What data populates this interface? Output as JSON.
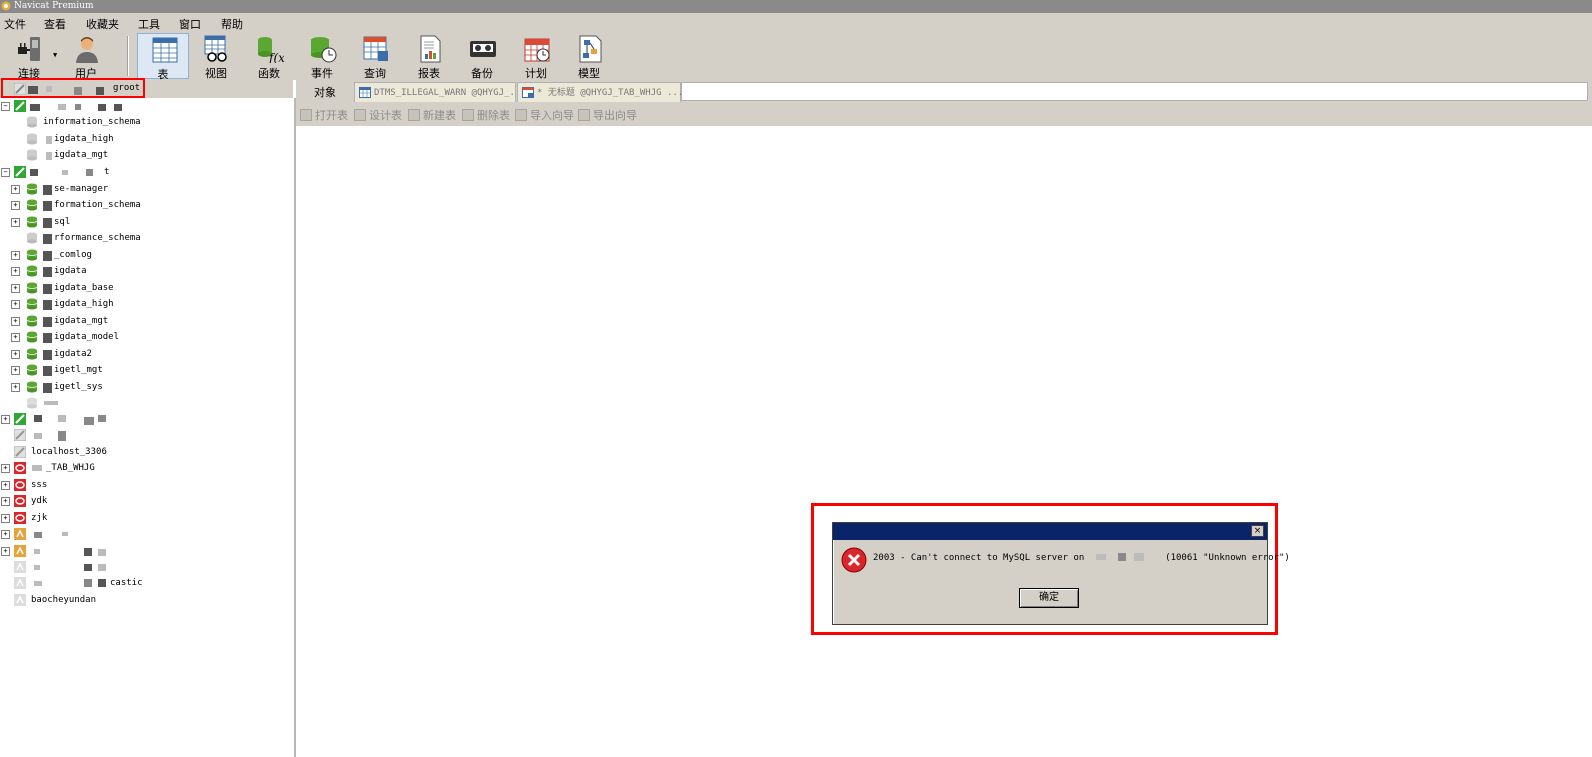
{
  "app": {
    "title": "Navicat Premium"
  },
  "menu": [
    "文件",
    "查看",
    "收藏夹",
    "工具",
    "窗口",
    "帮助"
  ],
  "toolbar": {
    "buttons": [
      {
        "label": "连接",
        "icon": "connect-plug-icon"
      },
      {
        "label": "用户",
        "icon": "user-icon"
      },
      {
        "label": "表",
        "icon": "table-icon",
        "active": true
      },
      {
        "label": "视图",
        "icon": "view-glasses-icon"
      },
      {
        "label": "函数",
        "icon": "function-icon"
      },
      {
        "label": "事件",
        "icon": "event-clock-icon"
      },
      {
        "label": "查询",
        "icon": "query-icon"
      },
      {
        "label": "报表",
        "icon": "report-icon"
      },
      {
        "label": "备份",
        "icon": "backup-icon"
      },
      {
        "label": "计划",
        "icon": "schedule-calendar-icon"
      },
      {
        "label": "模型",
        "icon": "model-icon"
      }
    ]
  },
  "connection_header": {
    "label": "groot"
  },
  "tree": {
    "connection1_children": [
      "information_schema",
      "igdata_high",
      "igdata_mgt"
    ],
    "connection2_label": "t",
    "connection2_children": [
      "se-manager",
      "formation_schema",
      "sql",
      "rformance_schema",
      "_comlog",
      "igdata",
      "igdata_base",
      "igdata_high",
      "igdata_mgt",
      "igdata_model",
      "igdata2",
      "igetl_mgt",
      "igetl_sys"
    ],
    "connections": [
      "localhost_3306",
      "_TAB_WHJG",
      "sss",
      "ydk",
      "zjk",
      "castic",
      "baocheyundan"
    ]
  },
  "tabs": {
    "objects_label": "对象",
    "tab1": "DTMS_ILLEGAL_WARN @QHYGJ_...",
    "tab2": "* 无标题 @QHYGJ_TAB_WHJG ..."
  },
  "object_toolbar": [
    "打开表",
    "设计表",
    "新建表",
    "删除表",
    "导入向导",
    "导出向导"
  ],
  "dialog": {
    "message_prefix": "2003 - Can't connect to MySQL server on",
    "message_suffix": "(10061 \"Unknown error\")",
    "ok_label": "确定",
    "close_glyph": "×"
  },
  "colors": {
    "red_highlight": "#ff0000",
    "dialog_caption": "#0a246a",
    "db_green": "#5aa832",
    "oracle_red": "#d9262b",
    "mysql_green": "#2ea832"
  }
}
